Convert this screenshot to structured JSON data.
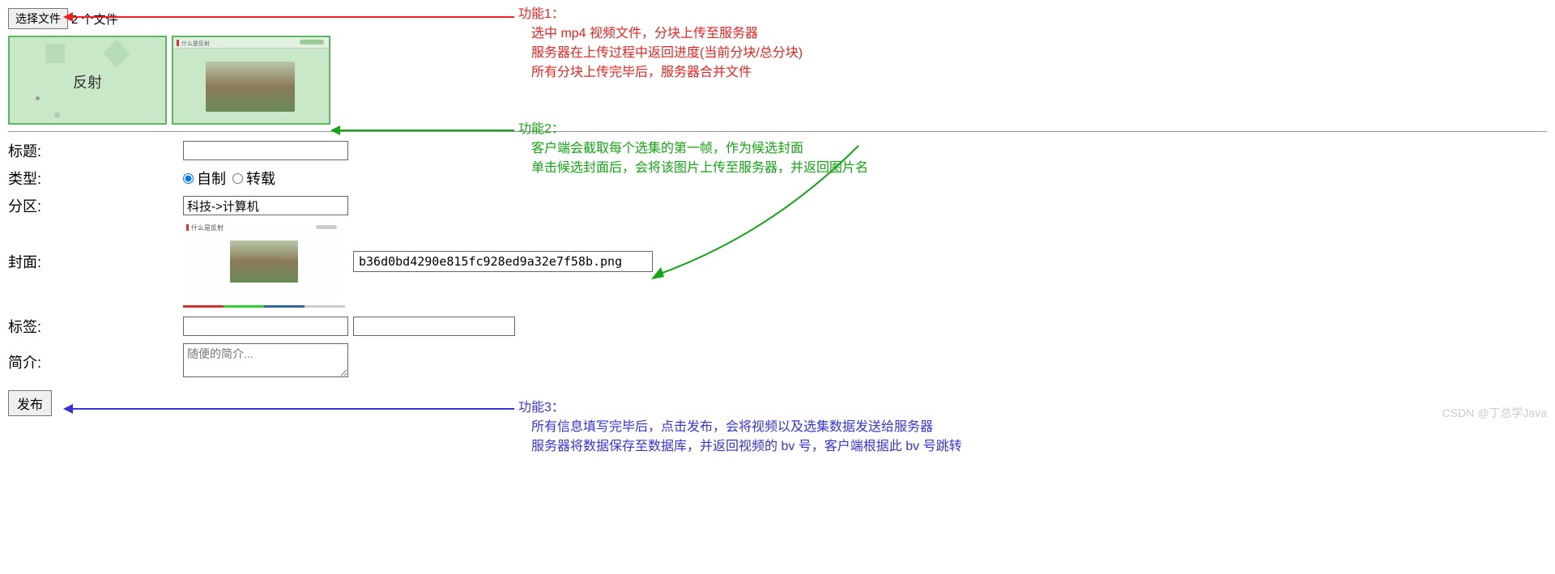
{
  "file_selector": {
    "button": "选择文件",
    "status": "2 个文件"
  },
  "thumb1_text": "反射",
  "thumb1_footer": "◎",
  "thumb2_title": "什么是反射",
  "form": {
    "title_label": "标题:",
    "type_label": "类型:",
    "type_opt1": "自制",
    "type_opt2": "转载",
    "category_label": "分区:",
    "category_value": "科技->计算机",
    "cover_label": "封面:",
    "cover_thumb_title": "什么是反射",
    "cover_filename": "b36d0bd4290e815fc928ed9a32e7f58b.png",
    "tag_label": "标签:",
    "desc_label": "简介:",
    "desc_placeholder": "随便的简介...",
    "publish": "发布"
  },
  "callouts": {
    "f1_title": "功能1：",
    "f1_line1": "选中 mp4 视频文件，分块上传至服务器",
    "f1_line2": "服务器在上传过程中返回进度(当前分块/总分块)",
    "f1_line3": "所有分块上传完毕后，服务器合并文件",
    "f2_title": "功能2：",
    "f2_line1": "客户端会截取每个选集的第一帧，作为候选封面",
    "f2_line2": "单击候选封面后，会将该图片上传至服务器，并返回图片名",
    "f3_title": "功能3：",
    "f3_line1": "所有信息填写完毕后，点击发布，会将视频以及选集数据发送给服务器",
    "f3_line2": "服务器将数据保存至数据库，并返回视频的 bv 号，客户端根据此 bv 号跳转"
  },
  "watermark": "CSDN @丁总学Java"
}
